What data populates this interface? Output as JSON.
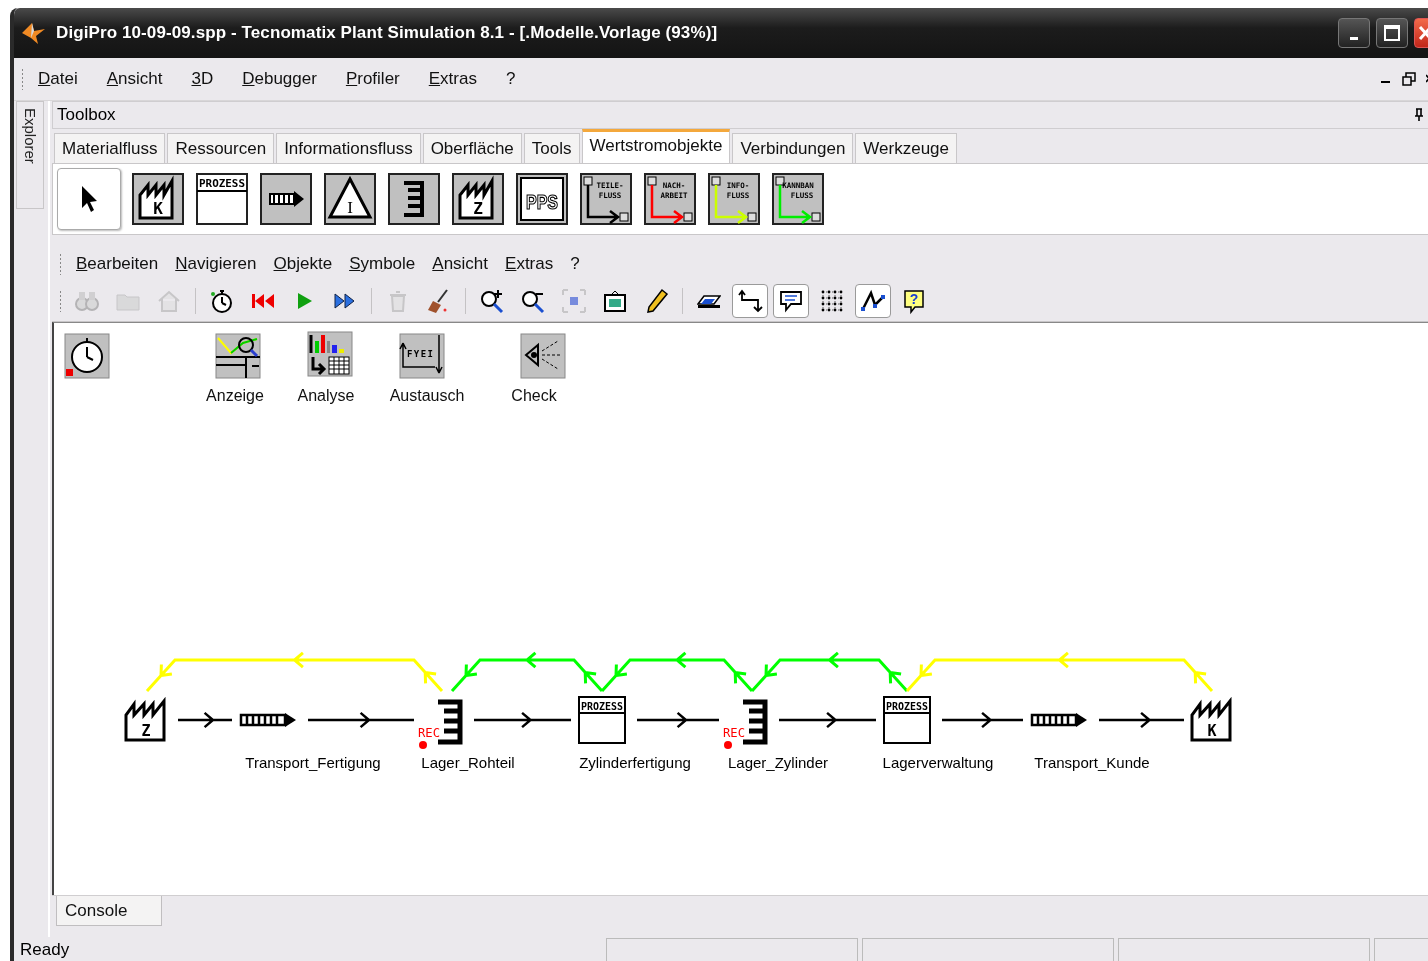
{
  "window": {
    "title": "DigiPro 10-09-09.spp - Tecnomatix Plant Simulation 8.1 - [.Modelle.Vorlage  (93%)]"
  },
  "menu": [
    "Datei",
    "Ansicht",
    "3D",
    "Debugger",
    "Profiler",
    "Extras",
    "?"
  ],
  "explorer_tab": "Explorer",
  "toolbox": {
    "title": "Toolbox",
    "tabs": [
      {
        "label": "Materialfluss",
        "selected": false
      },
      {
        "label": "Ressourcen",
        "selected": false
      },
      {
        "label": "Informationsfluss",
        "selected": false
      },
      {
        "label": "Oberfläche",
        "selected": false
      },
      {
        "label": "Tools",
        "selected": false
      },
      {
        "label": "Wertstromobjekte",
        "selected": true
      },
      {
        "label": "Verbindungen",
        "selected": false
      },
      {
        "label": "Werkzeuge",
        "selected": false
      }
    ],
    "items": [
      {
        "kind": "pointer",
        "selected": true
      },
      {
        "kind": "factory",
        "text": "K",
        "selected": false
      },
      {
        "kind": "process",
        "text": "PROZESS",
        "selected": false
      },
      {
        "kind": "transport",
        "selected": false
      },
      {
        "kind": "warning",
        "text": "I",
        "selected": false
      },
      {
        "kind": "store",
        "selected": false
      },
      {
        "kind": "factory",
        "text": "Z",
        "selected": false
      },
      {
        "kind": "box",
        "text": "PPS",
        "selected": false
      },
      {
        "kind": "flow",
        "lines": [
          "TEILE-",
          "FLUSS"
        ],
        "color": "#000000",
        "selected": false
      },
      {
        "kind": "flow",
        "lines": [
          "NACH-",
          "ARBEIT"
        ],
        "color": "#ff0000",
        "selected": false
      },
      {
        "kind": "flow",
        "lines": [
          "INFO-",
          "FLUSS"
        ],
        "color": "#ccff00",
        "selected": false
      },
      {
        "kind": "flow",
        "lines": [
          "KANNBAN",
          "FLUSS"
        ],
        "color": "#00ee00",
        "selected": false
      }
    ]
  },
  "editor_menu": [
    "Bearbeiten",
    "Navigieren",
    "Objekte",
    "Symbole",
    "Ansicht",
    "Extras",
    "?"
  ],
  "tool_groups": [
    [
      {
        "kind": "binoculars",
        "disabled": true,
        "pressed": false
      },
      {
        "kind": "folder",
        "disabled": true,
        "pressed": false
      },
      {
        "kind": "home",
        "disabled": true,
        "pressed": false
      }
    ],
    [
      {
        "kind": "stopwatch",
        "disabled": false,
        "pressed": false
      },
      {
        "kind": "rewind",
        "disabled": false,
        "pressed": false
      },
      {
        "kind": "play",
        "disabled": false,
        "pressed": false
      },
      {
        "kind": "fast-forward",
        "disabled": false,
        "pressed": false
      }
    ],
    [
      {
        "kind": "trash",
        "disabled": true,
        "pressed": false
      },
      {
        "kind": "broom",
        "disabled": false,
        "pressed": false
      }
    ],
    [
      {
        "kind": "zoom-in",
        "disabled": false,
        "pressed": false
      },
      {
        "kind": "zoom-out",
        "disabled": false,
        "pressed": false
      },
      {
        "kind": "fit",
        "disabled": true,
        "pressed": false
      },
      {
        "kind": "image",
        "disabled": false,
        "pressed": false
      },
      {
        "kind": "pencil",
        "disabled": false,
        "pressed": false
      }
    ],
    [
      {
        "kind": "eraser",
        "disabled": false,
        "pressed": false
      },
      {
        "kind": "connector",
        "disabled": false,
        "pressed": true
      },
      {
        "kind": "comment",
        "disabled": false,
        "pressed": true
      },
      {
        "kind": "grid",
        "disabled": false,
        "pressed": false
      },
      {
        "kind": "snap",
        "disabled": false,
        "pressed": true
      },
      {
        "kind": "help",
        "text": "?",
        "disabled": false,
        "pressed": false
      }
    ]
  ],
  "canvas_objects": [
    {
      "kind": "event_controller"
    },
    {
      "kind": "display",
      "label": "Anzeige"
    },
    {
      "kind": "analysis",
      "label": "Analyse"
    },
    {
      "kind": "exchange",
      "label": "Austausch",
      "text": "FYEI"
    },
    {
      "kind": "check",
      "label": "Check"
    }
  ],
  "diagram": {
    "nodes": [
      {
        "kind": "factory",
        "text": "Z"
      },
      {
        "kind": "transport",
        "label": "Transport_Fertigung"
      },
      {
        "kind": "store",
        "label": "Lager_Rohteil",
        "text": "REC"
      },
      {
        "kind": "process",
        "label": "Zylinderfertigung",
        "text": "PROZESS"
      },
      {
        "kind": "store",
        "label": "Lager_Zylinder",
        "text": "REC"
      },
      {
        "kind": "process",
        "label": "Lagerverwaltung",
        "text": "PROZESS"
      },
      {
        "kind": "transport",
        "label": "Transport_Kunde"
      },
      {
        "kind": "factory",
        "text": "K"
      }
    ],
    "feedback_flows": [
      {
        "color": "#ffff00"
      },
      {
        "color": "#00ff00"
      },
      {
        "color": "#00ff00"
      },
      {
        "color": "#00ff00"
      },
      {
        "color": "#ffff00"
      }
    ]
  },
  "console_tab": "Console",
  "status_bar": {
    "text": "Ready"
  }
}
